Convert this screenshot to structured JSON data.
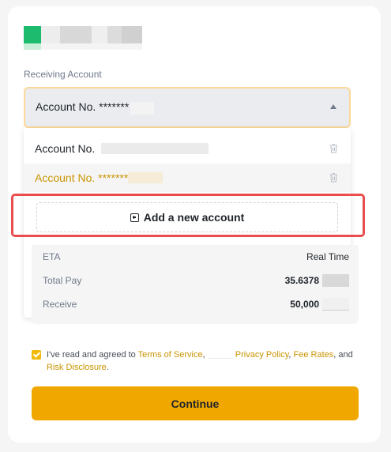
{
  "section_label": "Receiving Account",
  "selected": {
    "prefix": "Account No.",
    "masked": "*******"
  },
  "options": [
    {
      "prefix": "Account No.",
      "masked": ""
    },
    {
      "prefix": "Account No.",
      "masked": "*******"
    }
  ],
  "add_account_label": "Add a new account",
  "summary": {
    "eta_label": "ETA",
    "eta_value": "Real Time",
    "total_pay_label": "Total Pay",
    "total_pay_value": "35.6378",
    "receive_label": "Receive",
    "receive_value": "50,000"
  },
  "agreement": {
    "prefix": "I've read and agreed to",
    "terms": "Terms of Service",
    "comma1": ",",
    "privacy": "Privacy Policy",
    "comma2": ",",
    "fee": "Fee Rates",
    "and": ", and",
    "risk": "Risk Disclosure",
    "period": "."
  },
  "continue_label": "Continue",
  "colors": {
    "accent": "#f0a800",
    "link": "#c99400",
    "highlight": "#e84e4e",
    "logo_green": "#1dbb6d"
  }
}
